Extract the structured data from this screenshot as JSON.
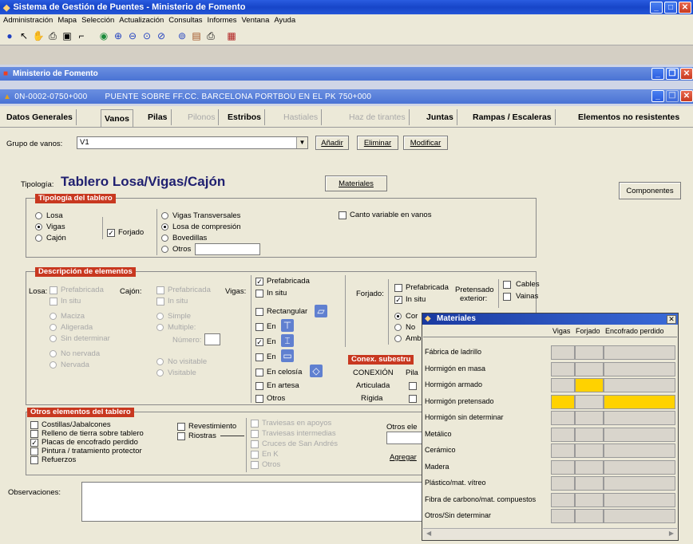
{
  "app": {
    "title": "Sistema de Gestión de Puentes - Ministerio de Fomento"
  },
  "menu": [
    "Administración",
    "Mapa",
    "Selección",
    "Actualización",
    "Consultas",
    "Informes",
    "Ventana",
    "Ayuda"
  ],
  "toolbar_icons": [
    "info-icon",
    "pointer-icon",
    "hand-icon",
    "print-icon",
    "copy-icon",
    "measure-icon",
    "globe-icon",
    "zoom-in-icon",
    "zoom-out-icon",
    "zoom-window-icon",
    "zoom-prev-icon",
    "zoom-extent-icon",
    "layers-icon",
    "print2-icon",
    "map-icon"
  ],
  "win2": {
    "title": "Ministerio de Fomento"
  },
  "win3": {
    "code": "0N-0002-0750+000",
    "name": "PUENTE SOBRE FF.CC. BARCELONA PORTBOU EN EL PK 750+000"
  },
  "tabs": [
    "Datos Generales",
    "Vanos",
    "Pilas",
    "Pilonos",
    "Estribos",
    "Hastiales",
    "Haz de tirantes",
    "Juntas",
    "Rampas / Escaleras",
    "Elementos no resistentes"
  ],
  "grupo": {
    "label": "Grupo de vanos:",
    "value": "V1",
    "add": "Añadir",
    "del": "Eliminar",
    "mod": "Modificar"
  },
  "tipologia": {
    "label": "Tipología:",
    "value": "Tablero Losa/Vigas/Cajón",
    "materiales": "Materiales",
    "componentes": "Componentes"
  },
  "tt": {
    "title": "Tipología del tablero",
    "losa": "Losa",
    "vigas": "Vigas",
    "cajon": "Cajón",
    "forjado": "Forjado",
    "vt": "Vigas Transversales",
    "lc": "Losa de compresión",
    "bov": "Bovedillas",
    "otros": "Otros",
    "canto": "Canto variable en vanos"
  },
  "de": {
    "title": "Descripción de elementos",
    "losa": "Losa:",
    "pref": "Prefabricada",
    "insitu": "In situ",
    "maciza": "Maciza",
    "aligerada": "Aligerada",
    "sindet": "Sin determinar",
    "nonerv": "No nervada",
    "nerv": "Nervada",
    "cajon": "Cajón:",
    "simple": "Simple",
    "multiple": "Multiple:",
    "numero": "Número:",
    "novisit": "No visitable",
    "visit": "Visitable",
    "vigas": "Vigas:",
    "rect": "Rectangular",
    "en": "En",
    "celosia": "En celosía",
    "artesa": "En artesa",
    "otros": "Otros",
    "forjado": "Forjado:",
    "cor": "Cor",
    "no": "No",
    "amb": "Amb",
    "pret": "Pretensado",
    "ext": "exterior:",
    "cables": "Cables",
    "vainas": "Vainas"
  },
  "conex": {
    "title": "Conex. subestru",
    "col1": "CONEXIÓN",
    "col2": "Pila",
    "art": "Articulada",
    "rig": "Rígida"
  },
  "oe": {
    "title": "Otros elementos del tablero",
    "items": [
      "Costillas/Jabalcones",
      "Relleno de tierra sobre tablero",
      "Placas de encofrado perdido",
      "Pintura / tratamiento protector",
      "Refuerzos"
    ],
    "rev": "Revestimiento",
    "riostras": "Riostras",
    "sub": [
      "Traviesas en apoyos",
      "Traviesas intermedias",
      "Cruces de San Andrés",
      "En K",
      "Otros"
    ],
    "otrosel": "Otros ele",
    "agregar": "Agregar"
  },
  "obs": {
    "label": "Observaciones:"
  },
  "mat": {
    "title": "Materiales",
    "cols": [
      "Vigas",
      "Forjado",
      "Encofrado perdido"
    ],
    "rows": [
      "Fábrica de ladrillo",
      "Hormigón en masa",
      "Hormigón armado",
      "Hormigón pretensado",
      "Hormigón sin determinar",
      "Metálico",
      "Cerámico",
      "Madera",
      "Plástico/mat. vítreo",
      "Fibra de carbono/mat. compuestos",
      "Otros/Sin determinar"
    ],
    "highlight": "#ffd200"
  }
}
